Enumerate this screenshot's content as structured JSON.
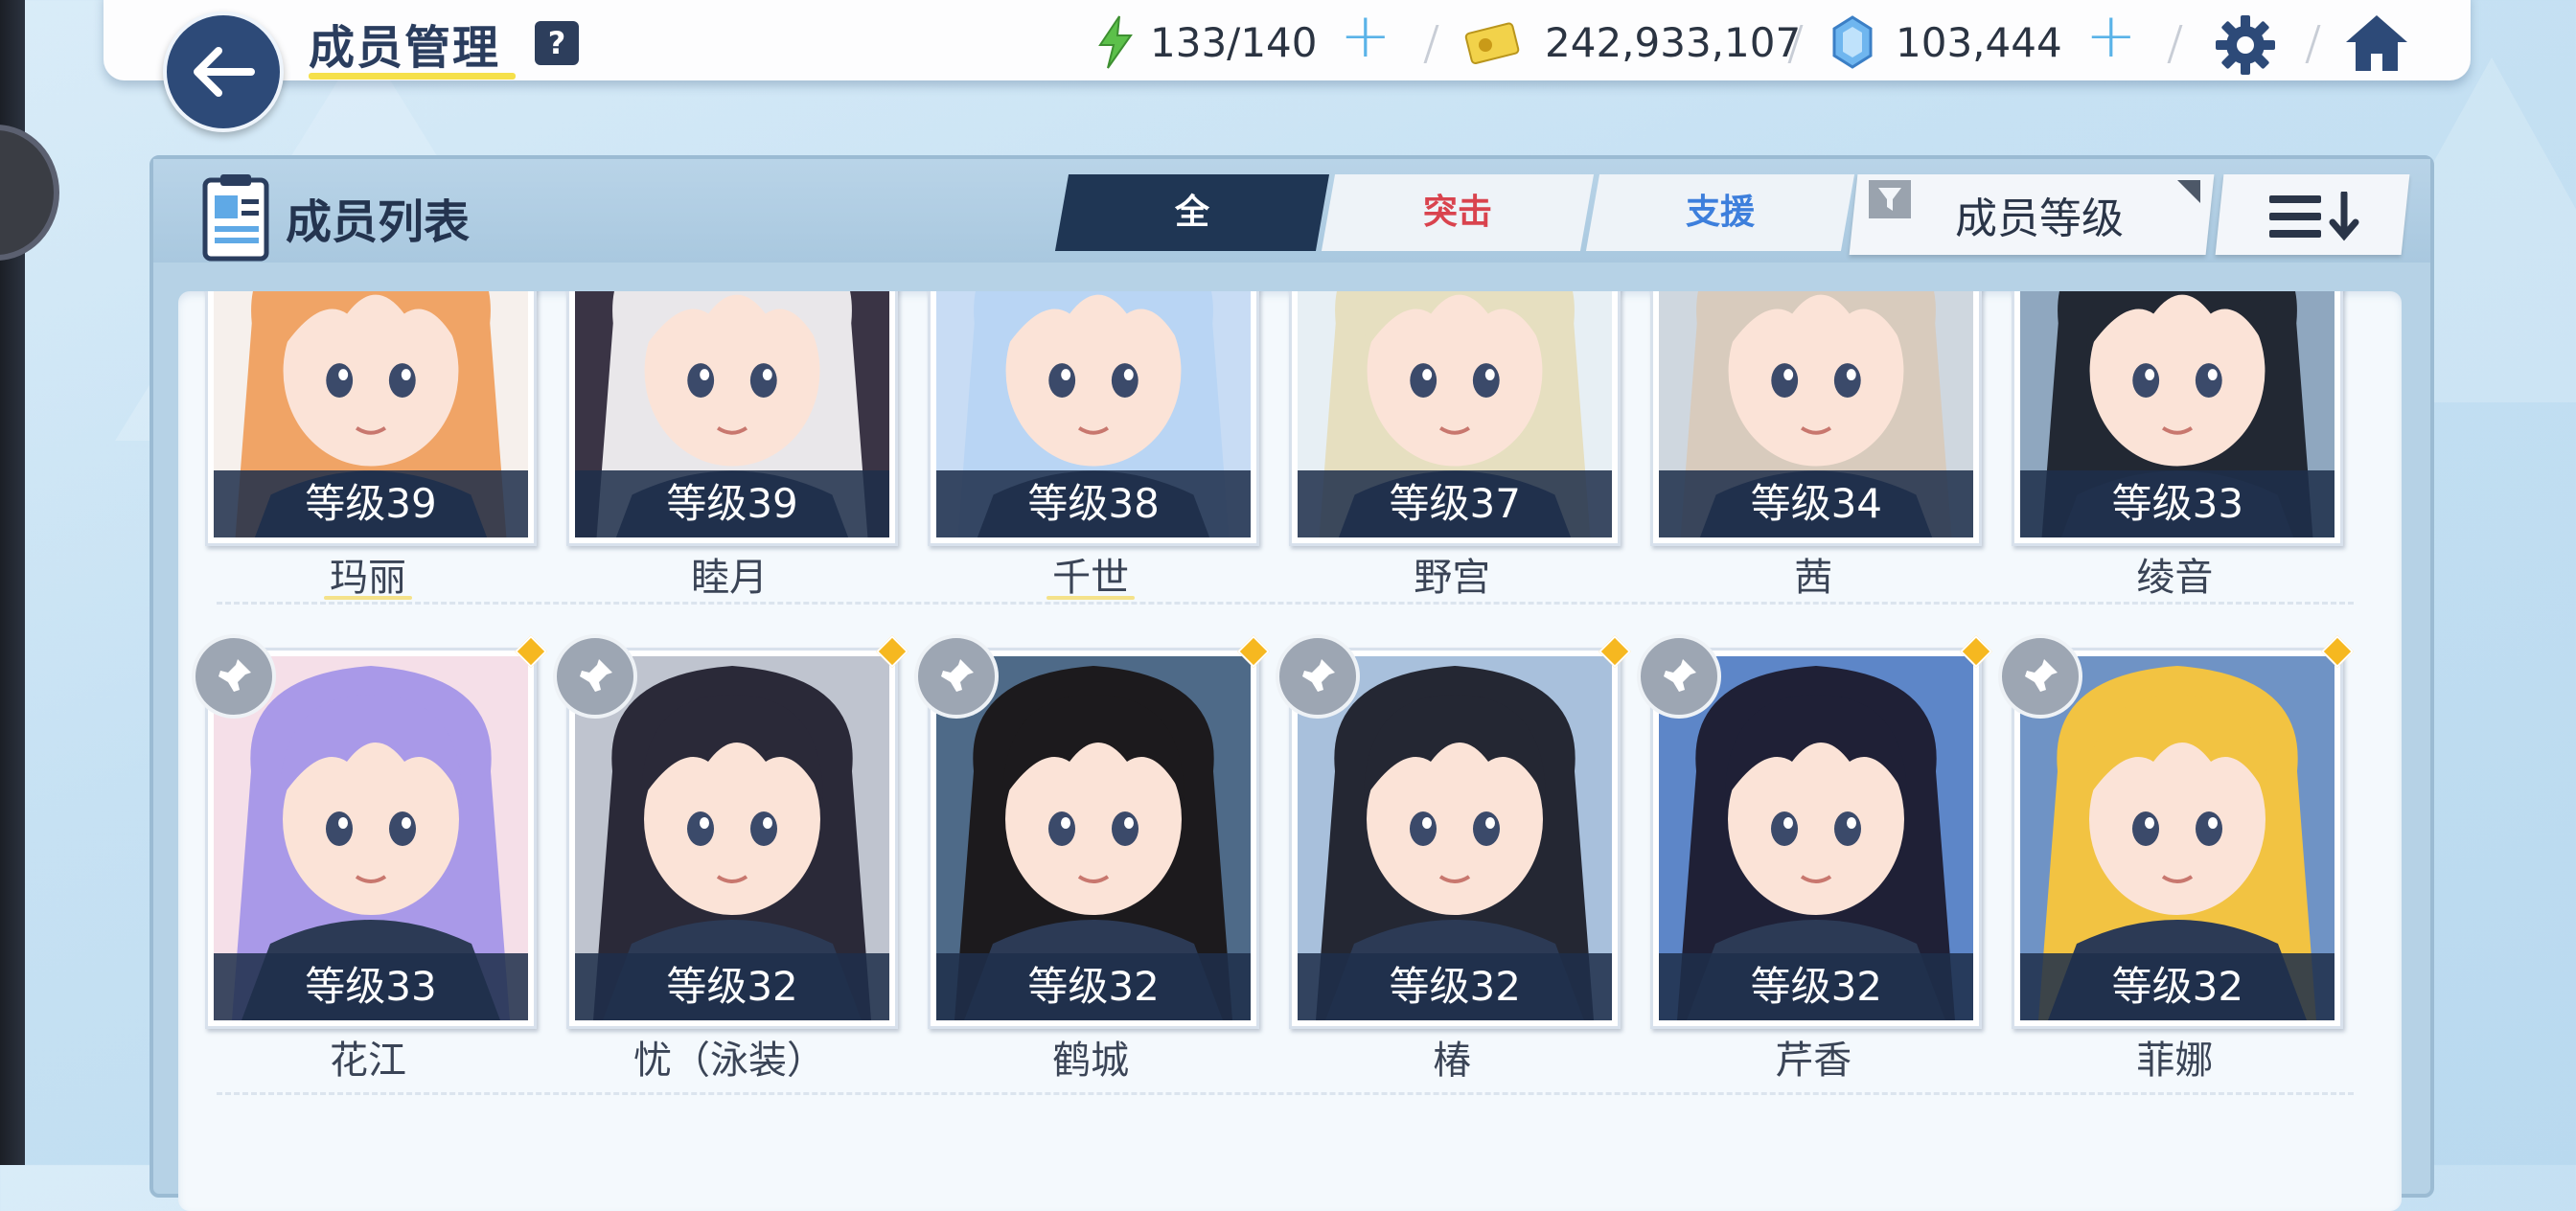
{
  "header": {
    "title": "成员管理",
    "help_label": "?",
    "stamina": "133/140",
    "credits": "242,933,107",
    "gems": "103,444",
    "plus_label": "+"
  },
  "panel": {
    "title": "成员列表",
    "tabs": [
      "全",
      "突击",
      "支援"
    ],
    "sort_label": "成员等级"
  },
  "rows": [
    [
      {
        "level": "等级39",
        "name": "玛丽",
        "hair": "#f0a466",
        "bg": "#f6f0ec"
      },
      {
        "level": "等级39",
        "name": "睦月",
        "hair": "#e9e7ea",
        "bg": "#3a3445"
      },
      {
        "level": "等级38",
        "name": "千世",
        "hair": "#b9d5f4",
        "bg": "#c8dcf4"
      },
      {
        "level": "等级37",
        "name": "野宫",
        "hair": "#e6dfc0",
        "bg": "#e7eff4"
      },
      {
        "level": "等级34",
        "name": "茜",
        "hair": "#d8cbbd",
        "bg": "#cfd7df"
      },
      {
        "level": "等级33",
        "name": "绫音",
        "hair": "#222833",
        "bg": "#8fa7bf"
      }
    ],
    [
      {
        "level": "等级33",
        "name": "花江",
        "hair": "#a999e8",
        "bg": "#f5dfe8"
      },
      {
        "level": "等级32",
        "name": "忧（泳装）",
        "hair": "#2a2938",
        "bg": "#bfc4cf"
      },
      {
        "level": "等级32",
        "name": "鹤城",
        "hair": "#1c1a1d",
        "bg": "#4e6a88"
      },
      {
        "level": "等级32",
        "name": "椿",
        "hair": "#242733",
        "bg": "#a8c0dc"
      },
      {
        "level": "等级32",
        "name": "芹香",
        "hair": "#1f2036",
        "bg": "#5d86c8"
      },
      {
        "level": "等级32",
        "name": "菲娜",
        "hair": "#f2c342",
        "bg": "#6f93c5"
      }
    ]
  ]
}
